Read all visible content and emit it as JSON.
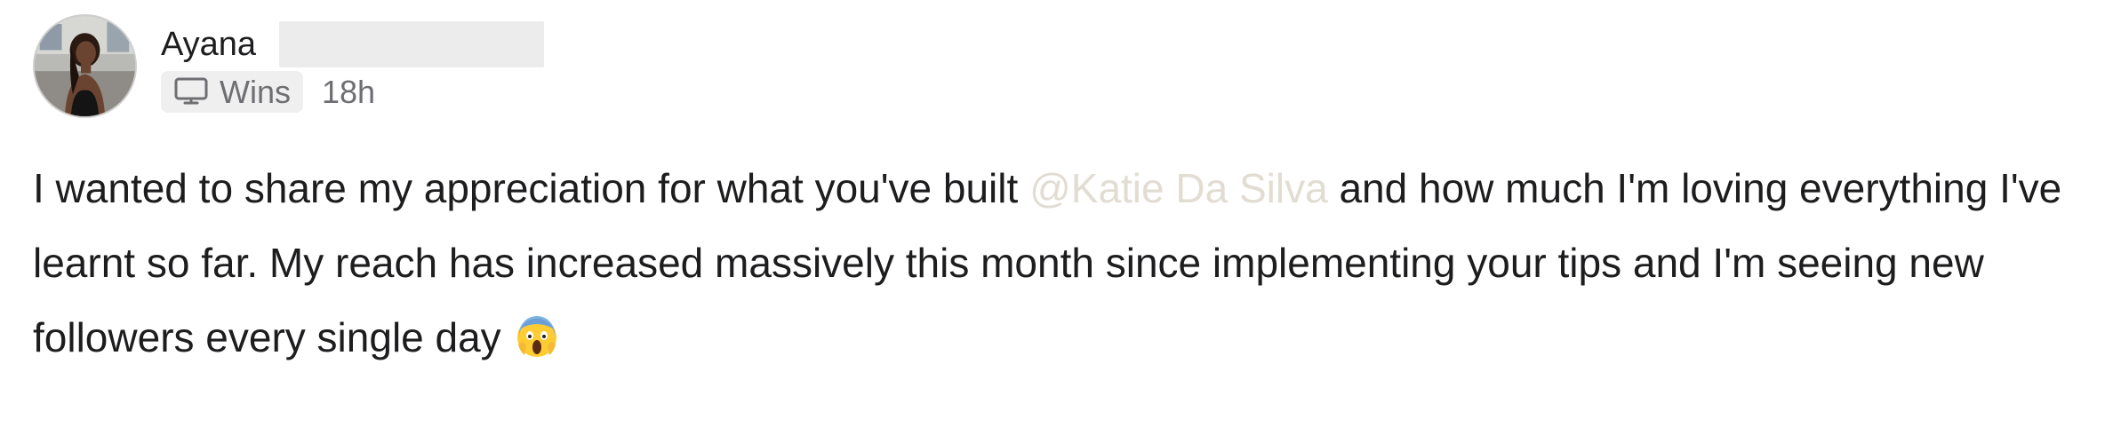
{
  "post": {
    "author": {
      "name": "Ayana",
      "avatar_icon": "avatar-photo"
    },
    "space": {
      "label": "Wins",
      "icon": "monitor-icon"
    },
    "timestamp": "18h",
    "body": {
      "part1": "I wanted to share my appreciation for what you've built ",
      "mention": "@Katie Da Silva",
      "part2": " and how much I'm loving everything I've learnt so far. My reach has increased massively this month since implementing your tips and I'm seeing new followers every single day ",
      "emoji": "face-screaming-in-fear"
    }
  },
  "colors": {
    "text": "#1d1d1f",
    "muted": "#6e6e73",
    "mention": "#e2ddd3",
    "tag_background": "#efefef",
    "redacted": "#ececec"
  }
}
